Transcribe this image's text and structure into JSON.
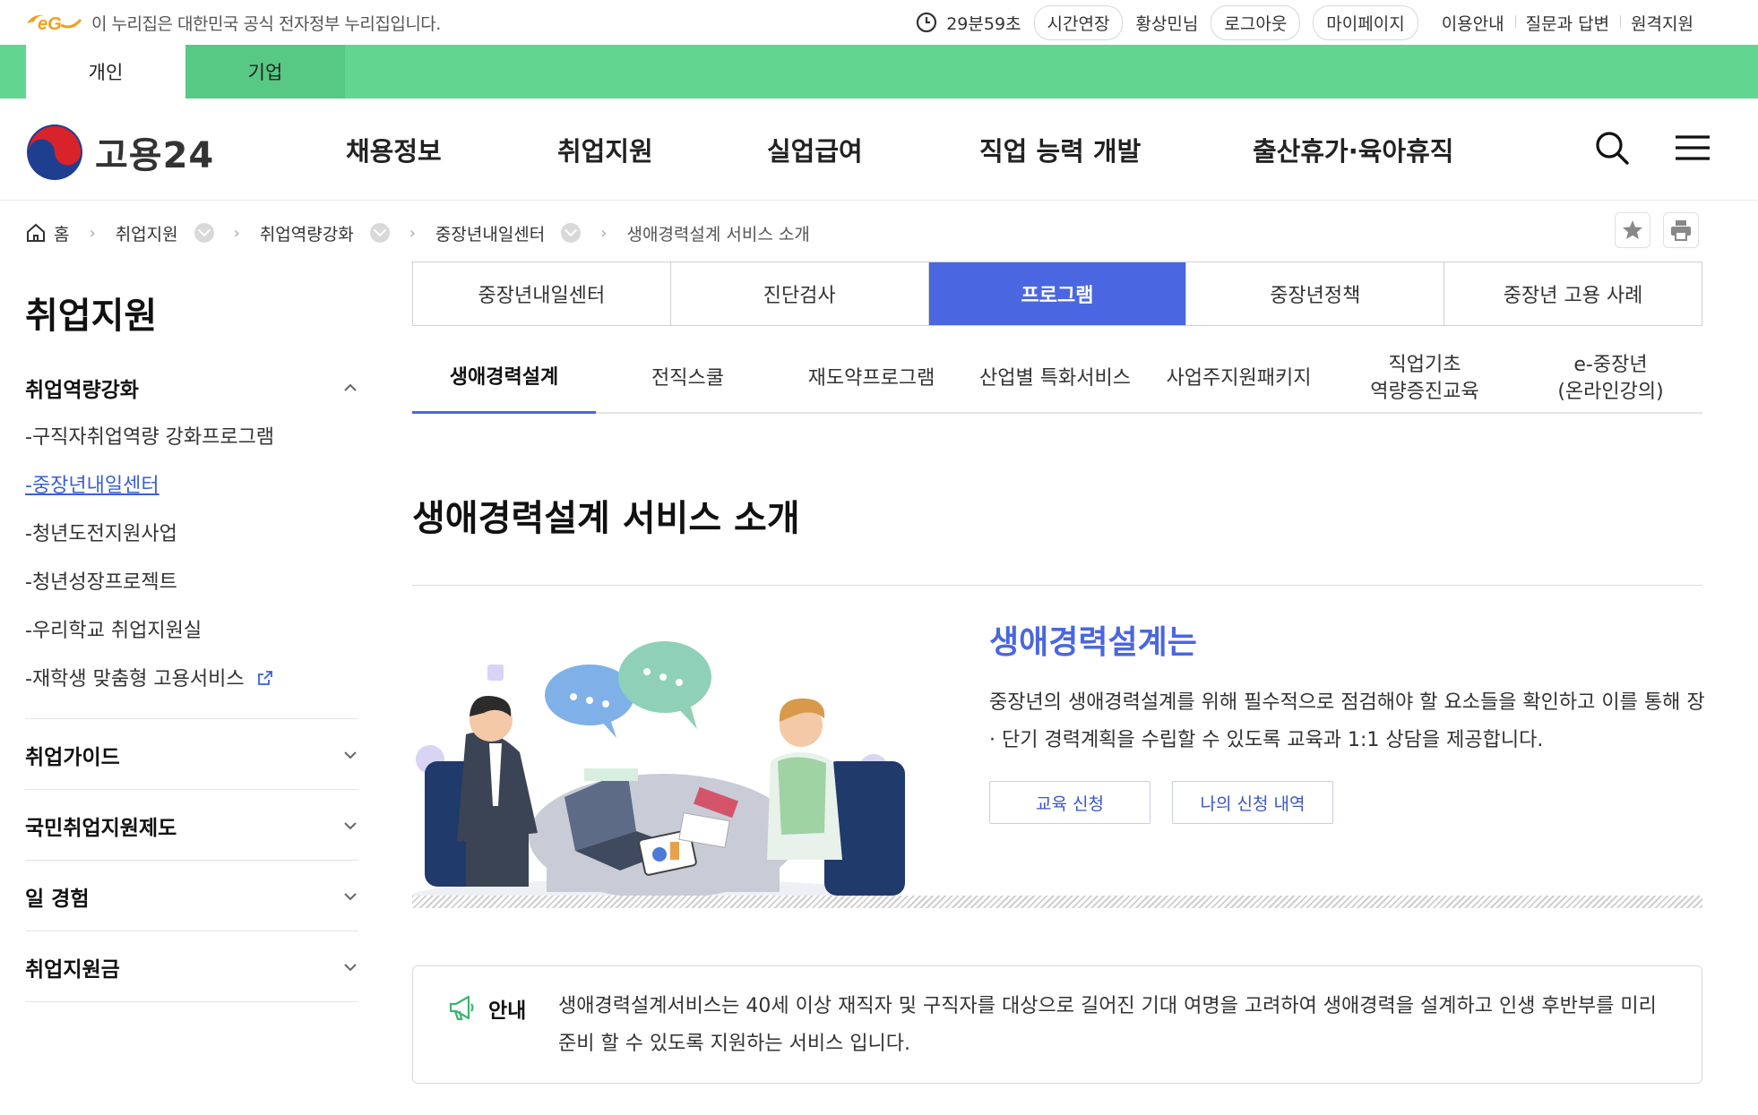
{
  "topbar": {
    "gov_notice": "이 누리집은 대한민국 공식 전자정부 누리집입니다.",
    "timer": "29분59초",
    "extend": "시간연장",
    "user": "황상민님",
    "logout": "로그아웃",
    "mypage": "마이페이지",
    "links": [
      "이용안내",
      "질문과 답변",
      "원격지원"
    ]
  },
  "audience_tabs": [
    "개인",
    "기업"
  ],
  "header": {
    "brand": "고용24",
    "gnb": [
      "채용정보",
      "취업지원",
      "실업급여",
      "직업 능력 개발",
      "출산휴가·육아휴직"
    ]
  },
  "breadcrumb": [
    "홈",
    "취업지원",
    "취업역량강화",
    "중장년내일센터",
    "생애경력설계 서비스 소개"
  ],
  "sidebar": {
    "title": "취업지원",
    "group_open": "취업역량강화",
    "subitems": [
      "-구직자취업역량 강화프로그램",
      "-중장년내일센터",
      "-청년도전지원사업",
      "-청년성장프로젝트",
      "-우리학교 취업지원실",
      "-재학생 맞춤형 고용서비스"
    ],
    "groups": [
      "취업가이드",
      "국민취업지원제도",
      "일 경험",
      "취업지원금"
    ]
  },
  "tabs_primary": [
    "중장년내일센터",
    "진단검사",
    "프로그램",
    "중장년정책",
    "중장년 고용 사례"
  ],
  "tabs_secondary": [
    "생애경력설계",
    "전직스쿨",
    "재도약프로그램",
    "산업별 특화서비스",
    "사업주지원패키지",
    "직업기초\n역량증진교육",
    "e-중장년\n(온라인강의)"
  ],
  "content": {
    "page_title": "생애경력설계 서비스 소개",
    "intro_title": "생애경력설계는",
    "intro_desc": "중장년의 생애경력설계를 위해 필수적으로 점검해야 할 요소들을 확인하고 이를 통해 장 · 단기 경력계획을 수립할 수 있도록 교육과 1:1 상담을 제공합니다.",
    "btn_apply": "교육 신청",
    "btn_history": "나의 신청 내역",
    "notice_label": "안내",
    "notice_text": "생애경력설계서비스는 40세 이상 재직자 및 구직자를 대상으로 길어진 기대 여명을 고려하여 생애경력을 설계하고 인생 후반부를 미리 준비 할 수 있도록 지원하는 서비스 입니다."
  },
  "colors": {
    "green": "#62d591",
    "accent": "#4a66e0",
    "link": "#3a5fd8"
  }
}
